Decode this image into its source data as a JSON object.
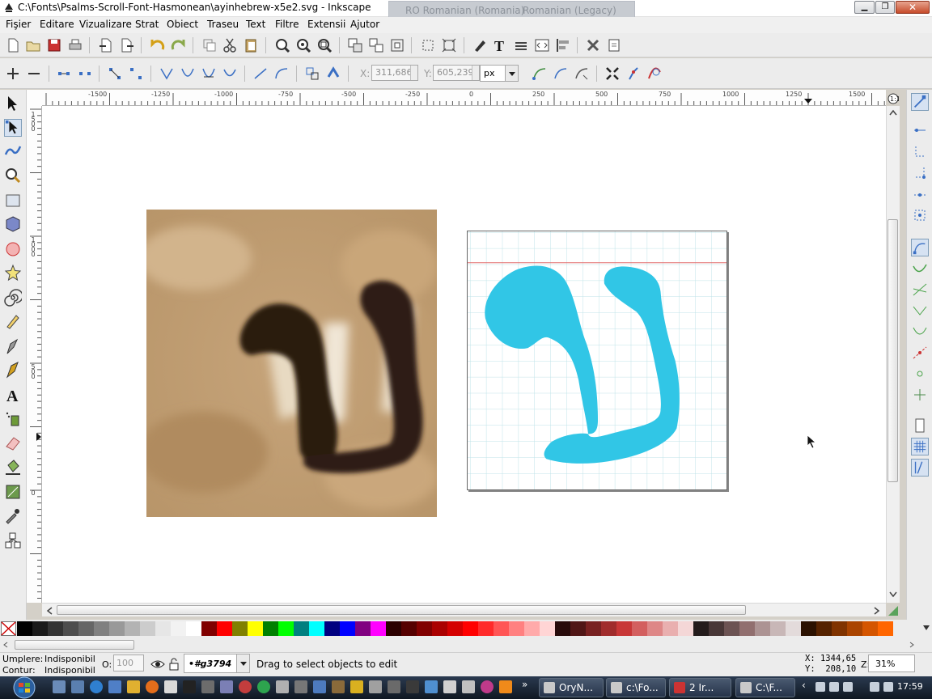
{
  "window": {
    "title": "C:\\Fonts\\Psalms-Scroll-Font-Hasmonean\\ayinhebrew-x5e2.svg - Inkscape",
    "language_bar": {
      "language": "RO Romanian (Romania)",
      "layout": "Romanian (Legacy)"
    }
  },
  "menu": [
    "Fişier",
    "Editare",
    "Vizualizare",
    "Strat",
    "Obiect",
    "Traseu",
    "Text",
    "Filtre",
    "Extensii",
    "Ajutor"
  ],
  "node_toolbar": {
    "x_label": "X:",
    "x_value": "311,686",
    "y_label": "Y:",
    "y_value": "605,239",
    "unit": "px"
  },
  "rulers": {
    "horizontal": [
      "-1500",
      "-1250",
      "-1000",
      "-750",
      "-500",
      "-250",
      "0",
      "250",
      "500",
      "750",
      "1000",
      "1250",
      "1500"
    ],
    "vertical": [
      "1500",
      "1000",
      "500",
      "0"
    ]
  },
  "palette": {
    "colors": [
      "#000000",
      "#1a1a1a",
      "#333333",
      "#4d4d4d",
      "#666666",
      "#808080",
      "#999999",
      "#b3b3b3",
      "#cccccc",
      "#e6e6e6",
      "#f2f2f2",
      "#ffffff",
      "#800000",
      "#ff0000",
      "#808000",
      "#ffff00",
      "#008000",
      "#00ff00",
      "#008080",
      "#00ffff",
      "#000080",
      "#0000ff",
      "#800080",
      "#ff00ff",
      "#2b0000",
      "#550000",
      "#800000",
      "#aa0000",
      "#d40000",
      "#ff0000",
      "#ff2a2a",
      "#ff5555",
      "#ff8080",
      "#ffaaaa",
      "#ffd5d5",
      "#280b0b",
      "#501616",
      "#782121",
      "#a02c2c",
      "#c83737",
      "#d35f5f",
      "#de8787",
      "#e9afaf",
      "#f4d7d7",
      "#241c1c",
      "#483737",
      "#6c5353",
      "#916f6f",
      "#ac9393",
      "#c8b7b7",
      "#e3dbdb",
      "#2b1100",
      "#552200",
      "#803300",
      "#aa4400",
      "#d45500",
      "#ff6600"
    ]
  },
  "status": {
    "fill_label": "Umplere:",
    "fill_value": "Indisponibil",
    "stroke_label": "Contur:",
    "stroke_value": "Indisponibil",
    "opacity_label": "O:",
    "opacity_value": "100",
    "layer": "•#g3794",
    "message": "Drag to select objects to edit",
    "coord_x_label": "X:",
    "coord_x": "1344,65",
    "coord_y_label": "Y:",
    "coord_y": "208,10",
    "zoom_label": "Z:",
    "zoom": "31%"
  },
  "taskbar": {
    "tasks": [
      "OryN...",
      "c:\\Fo...",
      "2 Ir...",
      "C:\\F..."
    ],
    "clock": "17:59"
  },
  "colors": {
    "glyph_fill": "#31c6e6",
    "grid": "#bfe3e8",
    "baseline": "#e26b6b"
  }
}
